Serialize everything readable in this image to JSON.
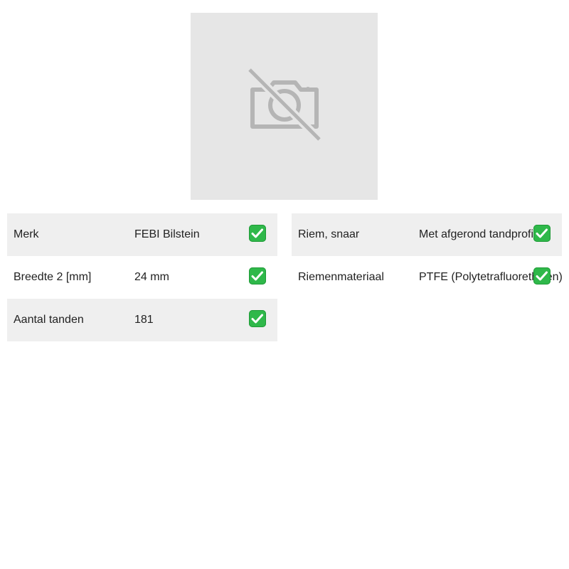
{
  "product_image": {
    "icon": "no-camera-icon"
  },
  "specs_left": [
    {
      "label": "Merk",
      "value": "FEBI Bilstein",
      "verified": true
    },
    {
      "label": "Breedte 2 [mm]",
      "value": "24 mm",
      "verified": true
    },
    {
      "label": "Aantal tanden",
      "value": "181",
      "verified": true
    }
  ],
  "specs_right": [
    {
      "label": "Riem, snaar",
      "value": "Met afgerond tandprofiel",
      "verified": true
    },
    {
      "label": "Riemenmateriaal",
      "value": "PTFE (Polytetrafluorethylen)",
      "verified": true
    }
  ],
  "colors": {
    "row_shade": "#efefef",
    "placeholder_bg": "#e6e6e6",
    "check_green": "#2fb84a"
  }
}
